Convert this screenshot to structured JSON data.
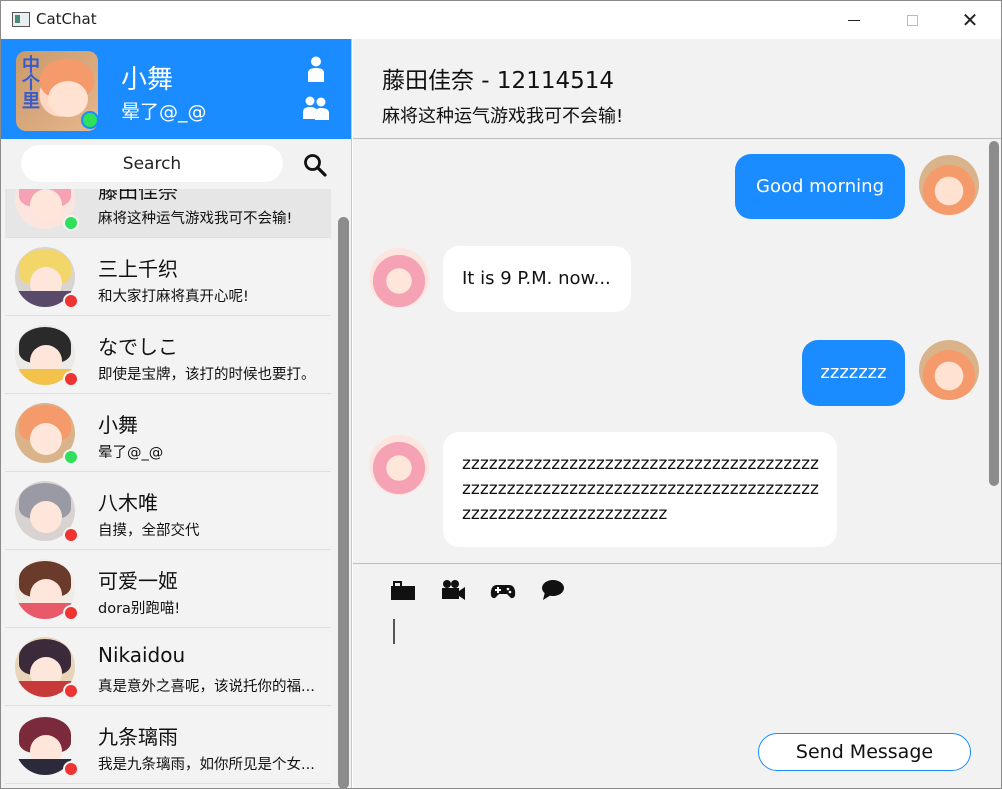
{
  "window": {
    "title": "CatChat"
  },
  "profile": {
    "name": "小舞",
    "signature": "晕了@_@",
    "status_color": "#2ee05a",
    "avatar_text": "中\n个\n里"
  },
  "search": {
    "placeholder": "Search"
  },
  "contacts": [
    {
      "name": "藤田佳奈",
      "message": "麻将这种运气游戏我可不会输!",
      "status": "online",
      "active": true
    },
    {
      "name": "三上千织",
      "message": "和大家打麻将真开心呢!",
      "status": "offline"
    },
    {
      "name": "なでしこ",
      "message": "即使是宝牌，该打的时候也要打。",
      "status": "offline"
    },
    {
      "name": "小舞",
      "message": "晕了@_@",
      "status": "online"
    },
    {
      "name": "八木唯",
      "message": "自摸，全部交代",
      "status": "offline"
    },
    {
      "name": "可爱一姬",
      "message": "dora别跑喵!",
      "status": "offline"
    },
    {
      "name": "Nikaidou",
      "message": "真是意外之喜呢，该说托你的福...",
      "status": "offline"
    },
    {
      "name": "九条璃雨",
      "message": "我是九条璃雨，如你所见是个女...",
      "status": "offline"
    }
  ],
  "chat": {
    "title": "藤田佳奈 - 12114514",
    "subtitle": "麻将这种运气游戏我可不会输!",
    "messages": [
      {
        "from": "me",
        "text": "Good morning"
      },
      {
        "from": "them",
        "text": "It is 9 P.M. now..."
      },
      {
        "from": "me",
        "text": "zzzzzzz"
      },
      {
        "from": "them",
        "text": "zzzzzzzzzzzzzzzzzzzzzzzzzzzzzzzzzzzzzzzzzzzzzzzzzzzzzzzzzzzzzzzzzzzzzzzzzzzzzzzzzzzzzzzzzzzzzzzzzzzzzzz"
      }
    ]
  },
  "composer": {
    "tools": [
      "briefcase-icon",
      "video-camera-icon",
      "gamepad-icon",
      "chat-bubble-icon"
    ],
    "send_label": "Send Message"
  },
  "colors": {
    "accent": "#1a8cff",
    "online": "#2ee05a",
    "offline": "#ee3333"
  }
}
